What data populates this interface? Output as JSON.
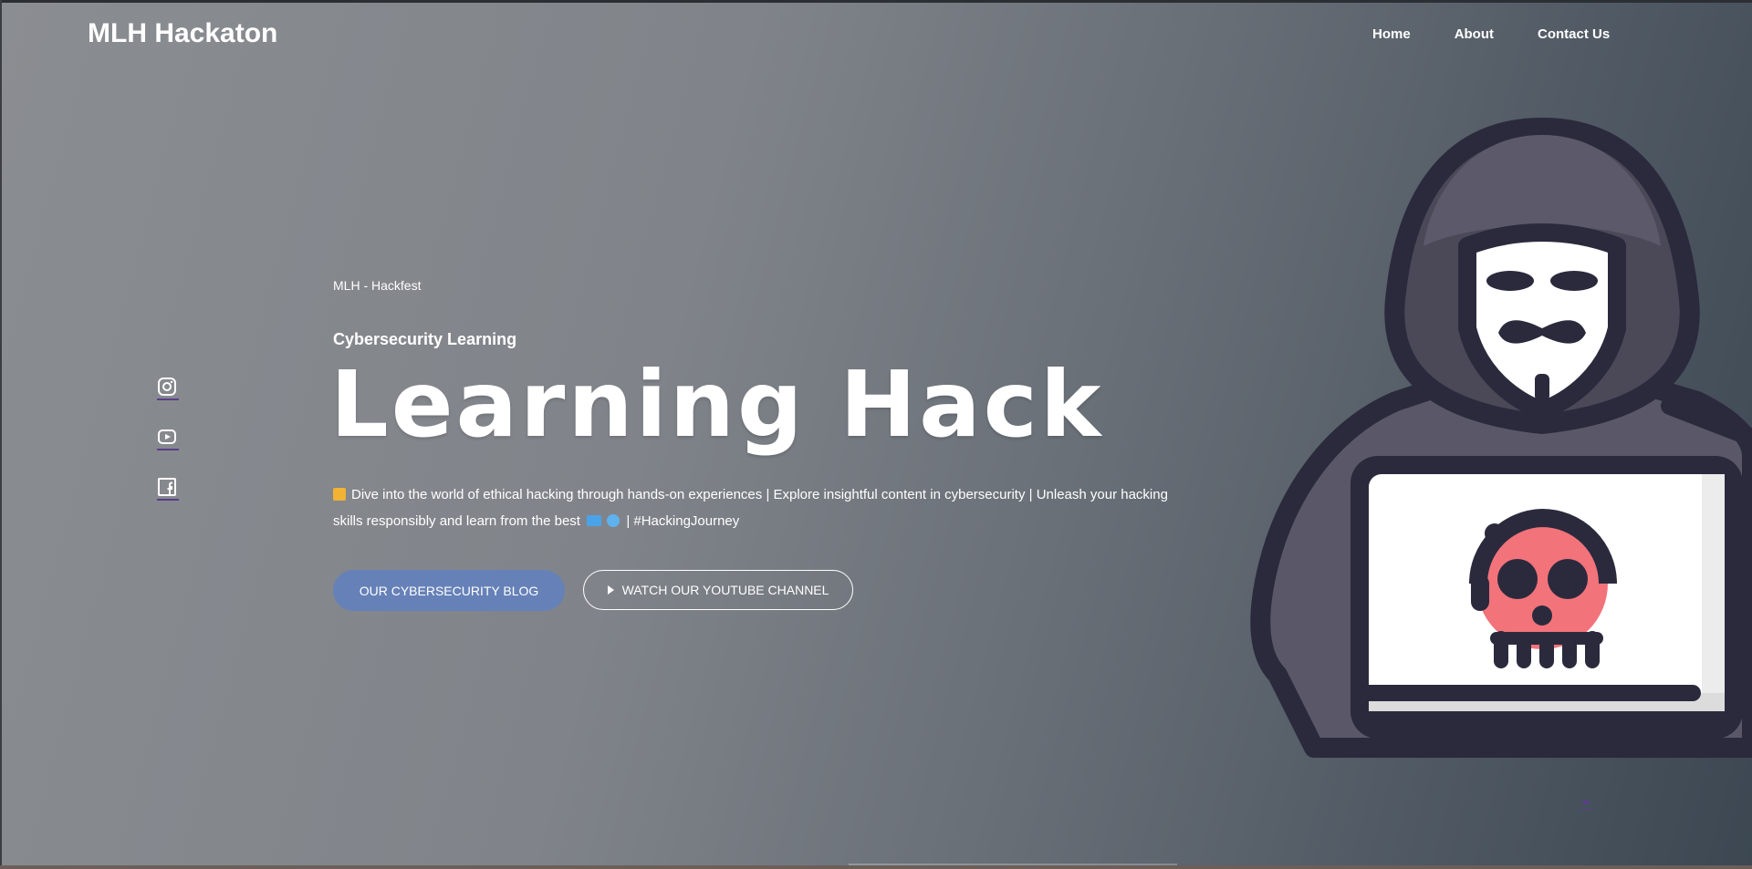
{
  "brand": {
    "name": "MLH Hackaton"
  },
  "nav": {
    "items": [
      "Home",
      "About",
      "Contact Us"
    ]
  },
  "social": {
    "icons": [
      "instagram-icon",
      "youtube-icon",
      "facebook-icon"
    ]
  },
  "hero": {
    "kicker": "MLH - Hackfest",
    "subtitle": "Cybersecurity Learning",
    "title": "Learning Hack",
    "description_part1": "Dive into the world of ethical hacking through hands-on experiences | Explore insightful content in cybersecurity | Unleash your hacking skills responsibly and learn from the best",
    "description_part2": "| #HackingJourney"
  },
  "buttons": {
    "blog": "OUR CYBERSECURITY BLOG",
    "youtube": "WATCH OUR YOUTUBE CHANNEL"
  },
  "colors": {
    "accent": "#6681b7",
    "skull": "#f3737b",
    "illustration_dark": "#2b2a3d"
  }
}
